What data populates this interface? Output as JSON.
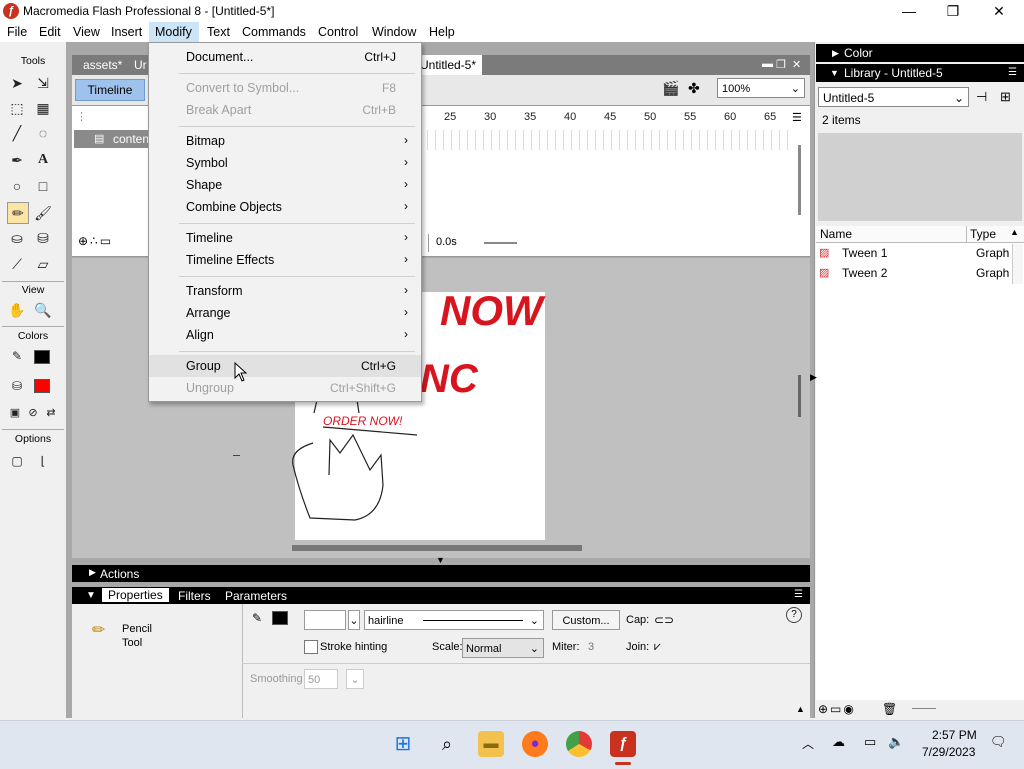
{
  "window": {
    "title": "Macromedia Flash Professional 8 - [Untitled-5*]",
    "app_icon_glyph": "ƒ",
    "minimize_glyph": "—",
    "maximize_glyph": "❐",
    "close_glyph": "✕"
  },
  "menubar": [
    "File",
    "Edit",
    "View",
    "Insert",
    "Modify",
    "Text",
    "Commands",
    "Control",
    "Window",
    "Help"
  ],
  "doc_tabs": {
    "tab1": "assets*",
    "tab2": "Ur",
    "active": "Untitled-5*"
  },
  "timeline": {
    "button_label": "Timeline",
    "layer_name": "conten",
    "ruler": [
      "25",
      "30",
      "35",
      "40",
      "45",
      "50",
      "55",
      "60",
      "65"
    ],
    "frame_time": "0.0s",
    "zoom": "100%"
  },
  "tools": {
    "header": "Tools",
    "view_header": "View",
    "colors_header": "Colors",
    "options_header": "Options",
    "stroke_color": "#000000",
    "fill_color": "#ff0000"
  },
  "stage": {
    "text_now": "NOW",
    "text_inc": "NC",
    "text_order": "ORDER NOW!"
  },
  "modify_menu": [
    {
      "label": "Document...",
      "shortcut": "Ctrl+J",
      "enabled": true,
      "submenu": false
    },
    {
      "label": "Convert to Symbol...",
      "shortcut": "F8",
      "enabled": false,
      "submenu": false
    },
    {
      "label": "Break Apart",
      "shortcut": "Ctrl+B",
      "enabled": false,
      "submenu": false
    },
    {
      "label": "Bitmap",
      "shortcut": "",
      "enabled": true,
      "submenu": true
    },
    {
      "label": "Symbol",
      "shortcut": "",
      "enabled": true,
      "submenu": true
    },
    {
      "label": "Shape",
      "shortcut": "",
      "enabled": true,
      "submenu": true
    },
    {
      "label": "Combine Objects",
      "shortcut": "",
      "enabled": true,
      "submenu": true
    },
    {
      "label": "Timeline",
      "shortcut": "",
      "enabled": true,
      "submenu": true
    },
    {
      "label": "Timeline Effects",
      "shortcut": "",
      "enabled": true,
      "submenu": true
    },
    {
      "label": "Transform",
      "shortcut": "",
      "enabled": true,
      "submenu": true
    },
    {
      "label": "Arrange",
      "shortcut": "",
      "enabled": true,
      "submenu": true
    },
    {
      "label": "Align",
      "shortcut": "",
      "enabled": true,
      "submenu": true
    },
    {
      "label": "Group",
      "shortcut": "Ctrl+G",
      "enabled": true,
      "submenu": false,
      "hovered": true
    },
    {
      "label": "Ungroup",
      "shortcut": "Ctrl+Shift+G",
      "enabled": false,
      "submenu": false
    }
  ],
  "actions_panel": {
    "title": "Actions"
  },
  "properties": {
    "tabs": [
      "Properties",
      "Filters",
      "Parameters"
    ],
    "tool_name": "Pencil",
    "tool_sub": "Tool",
    "stroke_style": "hairline",
    "custom_button": "Custom...",
    "cap_label": "Cap:",
    "stroke_hinting": "Stroke hinting",
    "scale_label": "Scale:",
    "scale_value": "Normal",
    "miter_label": "Miter:",
    "miter_value": "3",
    "join_label": "Join:",
    "smoothing_label": "Smoothing",
    "smoothing_value": "50",
    "help_glyph": "?"
  },
  "color_panel": {
    "title": "Color"
  },
  "library": {
    "title": "Library - Untitled-5",
    "doc_select": "Untitled-5",
    "count": "2 items",
    "col_name": "Name",
    "col_type": "Type",
    "items": [
      {
        "name": "Tween 1",
        "type": "Graph"
      },
      {
        "name": "Tween 2",
        "type": "Graph"
      }
    ]
  },
  "taskbar": {
    "time": "2:57 PM",
    "date": "7/29/2023"
  }
}
